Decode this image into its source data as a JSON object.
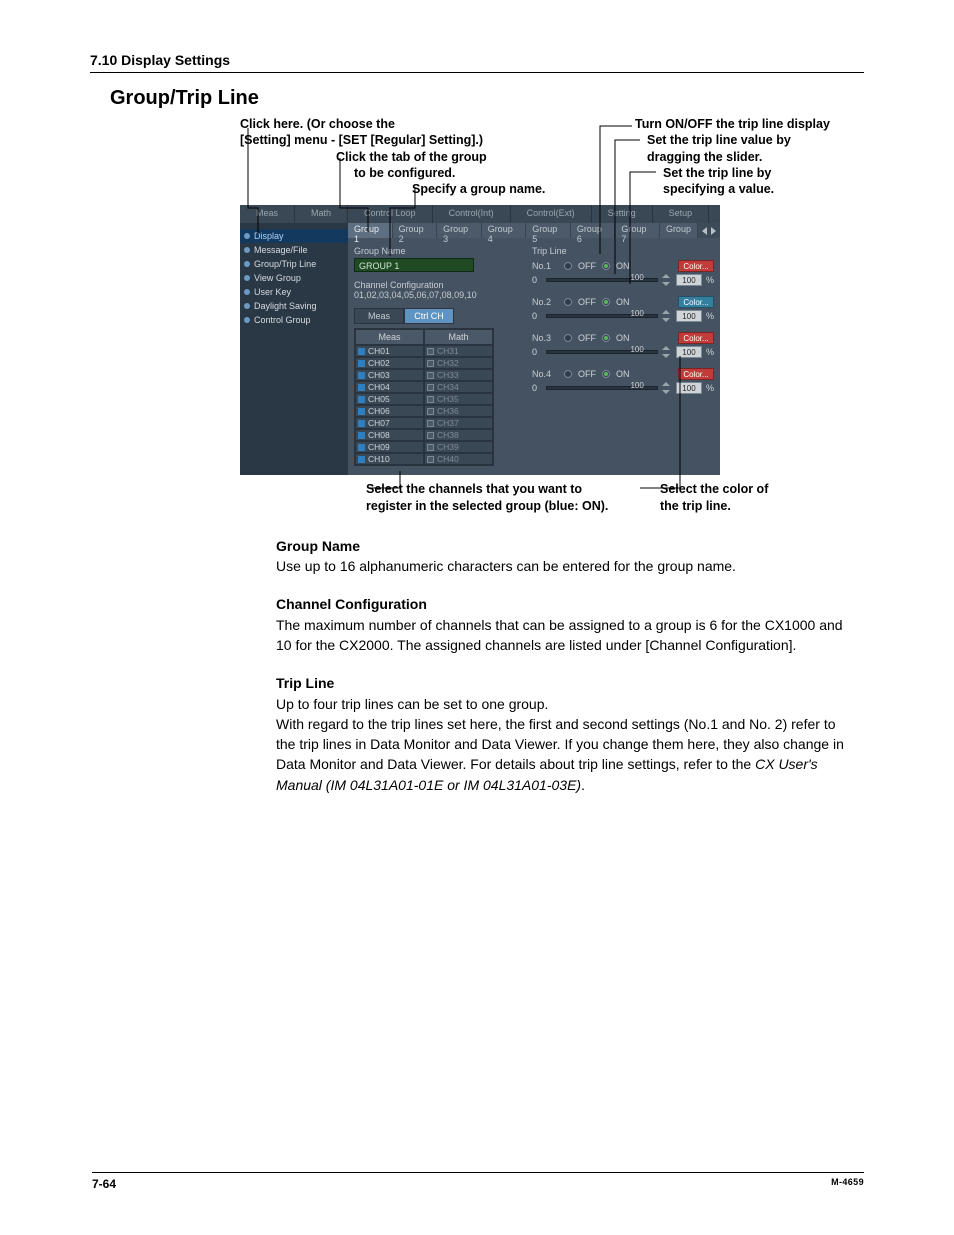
{
  "header": "7.10  Display Settings",
  "title": "Group/Trip Line",
  "callouts": {
    "top_left": {
      "l1": "Click here. (Or choose the",
      "l2": "[Setting] menu - [SET [Regular] Setting].)",
      "l3a": "Click the tab of the group",
      "l3b": "to be configured.",
      "l4": "Specify a group name."
    },
    "top_right": {
      "r1": "Turn ON/OFF the trip line display",
      "r2a": "Set the trip line value by",
      "r2b": "dragging the slider.",
      "r3a": "Set the trip line by",
      "r3b": "specifying a value."
    },
    "bottom_left": {
      "l1": "Select the channels that you want to",
      "l2": "register in the selected group (blue: ON)."
    },
    "bottom_right": {
      "l1": "Select the color of",
      "l2": "the trip line."
    }
  },
  "screenshot": {
    "top_tabs": [
      "Meas",
      "Math",
      "Control Loop",
      "Control(Int)",
      "Control(Ext)",
      "Setting",
      "Setup"
    ],
    "sidebar": [
      "Display",
      "Message/File",
      "Group/Trip Line",
      "View Group",
      "User Key",
      "Daylight Saving",
      "Control Group"
    ],
    "sidebar_selected": "Display",
    "group_tabs": [
      "Group 1",
      "Group 2",
      "Group 3",
      "Group 4",
      "Group 5",
      "Group 6",
      "Group 7",
      "Group"
    ],
    "group_selected": "Group 1",
    "group_name_label": "Group Name",
    "group_name_value": "GROUP 1",
    "channel_cfg_label": "Channel Configuration",
    "channel_cfg_value": "01,02,03,04,05,06,07,08,09,10",
    "subtabs": [
      "Meas",
      "Ctrl CH"
    ],
    "subtab_selected": "Ctrl CH",
    "ch_headers": [
      "Meas",
      "Math"
    ],
    "meas_rows": [
      "CH01",
      "CH02",
      "CH03",
      "CH04",
      "CH05",
      "CH06",
      "CH07",
      "CH08",
      "CH09",
      "CH10"
    ],
    "math_rows": [
      "CH31",
      "CH32",
      "CH33",
      "CH34",
      "CH35",
      "CH36",
      "CH37",
      "CH38",
      "CH39",
      "CH40"
    ],
    "trip_title": "Trip Line",
    "off_label": "OFF",
    "on_label": "ON",
    "color_label": "Color...",
    "trips": [
      {
        "no": "No.1",
        "slider_zero": "0",
        "tick": "100",
        "val": "100",
        "pct": "%"
      },
      {
        "no": "No.2",
        "slider_zero": "0",
        "tick": "100",
        "val": "100",
        "pct": "%"
      },
      {
        "no": "No.3",
        "slider_zero": "0",
        "tick": "100",
        "val": "100",
        "pct": "%"
      },
      {
        "no": "No.4",
        "slider_zero": "0",
        "tick": "100",
        "val": "100",
        "pct": "%"
      }
    ]
  },
  "body": {
    "s1_h": "Group Name",
    "s1_p": "Use up to 16 alphanumeric characters can be entered for the group name.",
    "s2_h": "Channel Configuration",
    "s2_p": "The maximum number of channels that can be assigned to a group is 6 for the CX1000 and 10 for the CX2000.  The assigned channels are listed under [Channel Configuration].",
    "s3_h": "Trip Line",
    "s3_p1": "Up to four trip lines can be set to one group.",
    "s3_p2a": "With regard to the trip lines set here, the first and second settings (No.1 and No. 2) refer to the trip lines in Data Monitor and Data Viewer.  If you change them here, they also change in Data Monitor and Data Viewer.  For details about trip line settings, refer to the ",
    "s3_p2b": "CX User's Manual (IM 04L31A01-01E or IM 04L31A01-03E)",
    "s3_p2c": "."
  },
  "footer": {
    "page": "7-64",
    "docid": "M-4659"
  }
}
